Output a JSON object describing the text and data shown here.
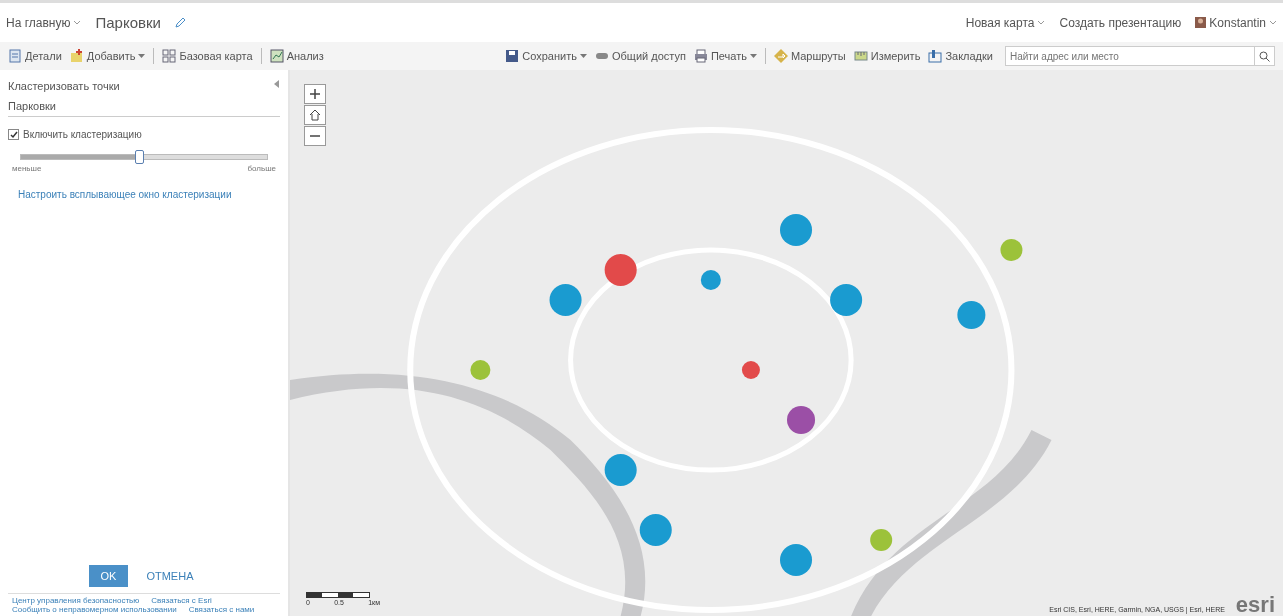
{
  "header": {
    "home": "На главную",
    "title": "Парковки",
    "new_map": "Новая карта",
    "presentation": "Создать презентацию",
    "user": "Konstantin"
  },
  "toolbar": {
    "left": [
      {
        "label": "Детали",
        "menu": false
      },
      {
        "label": "Добавить",
        "menu": true
      },
      {
        "label": "Базовая карта",
        "menu": false
      },
      {
        "label": "Анализ",
        "menu": false
      }
    ],
    "right": [
      {
        "label": "Сохранить",
        "menu": true
      },
      {
        "label": "Общий доступ",
        "menu": false
      },
      {
        "label": "Печать",
        "menu": true
      },
      {
        "label": "Маршруты",
        "menu": false
      },
      {
        "label": "Измерить",
        "menu": false
      },
      {
        "label": "Закладки",
        "menu": false
      }
    ],
    "search": {
      "placeholder": "Найти адрес или место"
    }
  },
  "panel": {
    "title": "Кластеризовать точки",
    "layer": "Парковки",
    "enable": {
      "label": "Включить кластеризацию",
      "checked": true
    },
    "slider": {
      "level": 0.48,
      "min_label": "меньше",
      "max_label": "больше"
    },
    "link": "Настроить всплывающее окно кластеризации",
    "ok": "OK",
    "cancel": "ОТМЕНА",
    "footer": [
      "Центр управления безопасностью",
      "Связаться с Esri",
      "Сообщить о неправомерном использовании",
      "Связаться с нами"
    ]
  },
  "map": {
    "scale": [
      "0",
      "0.5",
      "1км"
    ],
    "attribution": "Esri CIS, Esri, HERE, Garmin, NGA, USGS | Esri, HERE",
    "logo": "esri"
  }
}
